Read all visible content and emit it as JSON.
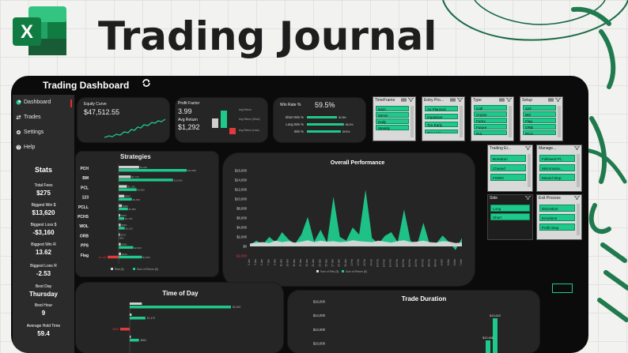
{
  "banner": {
    "title": "Trading Journal",
    "logo_letter": "X"
  },
  "dashboard": {
    "title": "Trading Dashboard"
  },
  "nav": [
    {
      "label": "Dashboard",
      "icon": "pie-icon"
    },
    {
      "label": "Trades",
      "icon": "swap-icon"
    },
    {
      "label": "Settings",
      "icon": "gear-icon"
    },
    {
      "label": "Help",
      "icon": "help-icon"
    }
  ],
  "stats": {
    "heading": "Stats",
    "items": [
      {
        "label": "Total Fees",
        "value": "$275"
      },
      {
        "label": "Biggest Win $",
        "value": "$13,620"
      },
      {
        "label": "Biggest Loss $",
        "value": "-$3,160"
      },
      {
        "label": "Biggest Win R",
        "value": "13.62"
      },
      {
        "label": "Biggest Loss R",
        "value": "-2.53"
      },
      {
        "label": "Best Day",
        "value": "Thursday"
      },
      {
        "label": "Best Hour",
        "value": "9"
      },
      {
        "label": "Average Hold Time",
        "value": "59.4"
      }
    ]
  },
  "equity": {
    "label": "Equity Curve",
    "value": "$47,512.55"
  },
  "profit": {
    "label": "Profit Factor",
    "value": "3.99",
    "avg_label": "Avg Return",
    "avg_value": "$1,292",
    "legend": [
      "Avg Return",
      "Avg Return (Short)",
      "Avg Return (Loss)"
    ]
  },
  "winrate": {
    "label": "Win Rate %",
    "value": "59.5%",
    "rows": [
      {
        "label": "Short Win %",
        "value": "52.8%",
        "fraction": 0.528
      },
      {
        "label": "Long Win %",
        "value": "65.0%",
        "fraction": 0.65
      },
      {
        "label": "Win %",
        "value": "59.5%",
        "fraction": 0.595
      }
    ]
  },
  "slicers": [
    {
      "name": "TimeFrame",
      "items": [
        "5min",
        "60min",
        "Daily",
        "Weekly"
      ]
    },
    {
      "name": "Entry Pro...",
      "items": [
        "As Planned",
        "Impulsive",
        "Too Early",
        "Too Late"
      ]
    },
    {
      "name": "Type",
      "items": [
        "Call",
        "Crypto",
        "Forex",
        "Future",
        "Put"
      ]
    },
    {
      "name": "Setup",
      "items": [
        "123",
        "BM",
        "Flag",
        "ORB",
        "PCH"
      ]
    },
    {
      "name": "Trading Er...",
      "items": [
        "Boredom",
        "Chased",
        "FOMO"
      ]
    },
    {
      "name": "Manage...",
      "items": [
        "Followed Pl...",
        "Micromana...",
        "Moved Stop"
      ]
    },
    {
      "name": "Side",
      "items": [
        "Long",
        "Short"
      ]
    },
    {
      "name": "Exit Process",
      "items": [
        "Discretion",
        "Emotions",
        "Profit Stop"
      ]
    }
  ],
  "strategies": {
    "title": "Strategies",
    "legend": [
      "Risk ($)",
      "Sum of Return ($)"
    ],
    "rows": [
      {
        "name": "PCH",
        "risk": 2930,
        "risk_label": "$2,930",
        "ret": 13658,
        "ret_label": "$13,658"
      },
      {
        "name": "BM",
        "risk": 1740,
        "risk_label": "$1,740",
        "ret": 10906,
        "ret_label": "$10,906"
      },
      {
        "name": "PCL",
        "risk": 1180,
        "risk_label": "$1,180",
        "ret": 3600,
        "ret_label": "$3,600"
      },
      {
        "name": "123",
        "risk": 820,
        "risk_label": "$820",
        "ret": 2660,
        "ret_label": "$2,660"
      },
      {
        "name": "PCLL",
        "risk": 480,
        "risk_label": "$480",
        "ret": 1860,
        "ret_label": "$1,860"
      },
      {
        "name": "PCHS",
        "risk": 240,
        "risk_label": "$240",
        "ret": 1130,
        "ret_label": "$1,130"
      },
      {
        "name": "WOL",
        "risk": 300,
        "risk_label": "$300",
        "ret": 1210,
        "ret_label": "$1,210"
      },
      {
        "name": "ORB",
        "risk": 170,
        "risk_label": "$170",
        "ret": 60,
        "ret_label": "$60"
      },
      {
        "name": "PPS",
        "risk": 300,
        "risk_label": "$300",
        "ret": 2940,
        "ret_label": "$2,940"
      },
      {
        "name": "Flag",
        "risk": 340,
        "risk_label": "$340",
        "ret": 4690,
        "ret_label": "$4,690",
        "neg": -1120,
        "neg_label": "-$1,120"
      }
    ]
  },
  "chart_data": [
    {
      "type": "area",
      "title": "Overall Performance",
      "ylim": [
        -2000,
        16000
      ],
      "y_ticks": [
        "-$2,000",
        "$0",
        "$2,000",
        "$4,000",
        "$6,000",
        "$8,000",
        "$10,000",
        "$12,000",
        "$14,000",
        "$16,000"
      ],
      "legend": [
        "Sum of Risk ($)",
        "Sum of Return ($)"
      ],
      "x": [
        "1-Jan",
        "3-Jan",
        "5-Jan",
        "7-Jan",
        "9-Jan",
        "11-Jan",
        "13-Jan",
        "15-Jan",
        "17-Jan",
        "19-Jan",
        "21-Jan",
        "23-Jan",
        "25-Jan",
        "27-Jan",
        "29-Jan",
        "31-Jan",
        "2-Feb",
        "4-Feb",
        "6-Feb",
        "8-Feb",
        "10-Feb",
        "12-Feb",
        "14-Feb",
        "16-Feb",
        "18-Feb",
        "20-Feb",
        "22-Feb",
        "24-Feb",
        "26-Feb",
        "28-Feb",
        "1-Mar",
        "3-Mar",
        "5-Mar",
        "7-Mar"
      ],
      "series": [
        {
          "name": "Sum of Return ($)",
          "values": [
            300,
            1200,
            400,
            2000,
            900,
            3000,
            1500,
            500,
            2500,
            6200,
            1000,
            3500,
            800,
            10500,
            2000,
            1200,
            4000,
            2500,
            12000,
            1800,
            500,
            2200,
            3000,
            900,
            7800,
            1200,
            300,
            5000,
            400,
            600,
            2300,
            900,
            -800,
            1800
          ]
        },
        {
          "name": "Sum of Risk ($)",
          "values": [
            600,
            800,
            900,
            700,
            1200,
            900,
            1100,
            800,
            1000,
            1300,
            900,
            1200,
            1000,
            1100,
            900,
            1000,
            1300,
            1100,
            1000,
            900,
            1200,
            1000,
            800,
            1100,
            1300,
            900,
            1000,
            1200,
            900,
            800,
            1100,
            1000,
            700,
            800
          ]
        }
      ]
    },
    {
      "type": "bar",
      "title": "Time of Day",
      "orientation": "horizontal",
      "rows": [
        {
          "label": "$9,500",
          "value": 9500,
          "neg": false
        },
        {
          "label": "$1,470",
          "value": 1470,
          "neg": false
        },
        {
          "label": "$120",
          "value": 120,
          "neg": true
        },
        {
          "label": "$860",
          "value": 860,
          "neg": false
        }
      ]
    },
    {
      "type": "bar",
      "title": "Trade Duration",
      "y_ticks": [
        "$10,000",
        "$12,000",
        "$14,000",
        "$16,000"
      ],
      "ylim": [
        9000,
        16000
      ],
      "data_labels": [
        "$13,620",
        "$10,468"
      ],
      "values": [
        13620,
        10468
      ]
    }
  ]
}
